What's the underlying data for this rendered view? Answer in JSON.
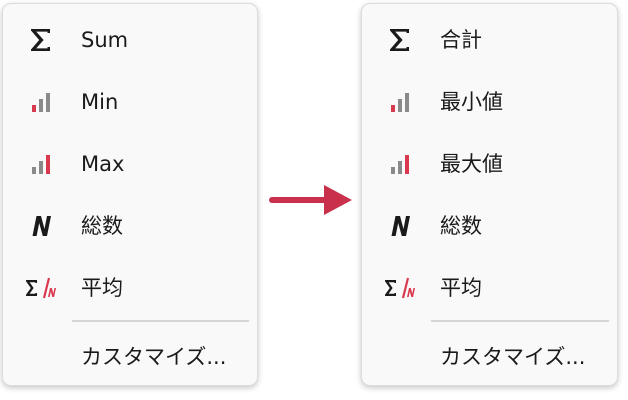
{
  "left_menu": {
    "items": [
      {
        "label": "Sum",
        "icon": "sigma-icon"
      },
      {
        "label": "Min",
        "icon": "min-bars-icon"
      },
      {
        "label": "Max",
        "icon": "max-bars-icon"
      },
      {
        "label": "総数",
        "icon": "count-n-icon"
      },
      {
        "label": "平均",
        "icon": "average-icon"
      }
    ],
    "customize_label": "カスタマイズ..."
  },
  "right_menu": {
    "items": [
      {
        "label": "合計",
        "icon": "sigma-icon"
      },
      {
        "label": "最小値",
        "icon": "min-bars-icon"
      },
      {
        "label": "最大値",
        "icon": "max-bars-icon"
      },
      {
        "label": "総数",
        "icon": "count-n-icon"
      },
      {
        "label": "平均",
        "icon": "average-icon"
      }
    ],
    "customize_label": "カスタマイズ..."
  },
  "colors": {
    "accent_red": "#d9394e",
    "arrow": "#c8304c",
    "icon_dark": "#1a1a1a",
    "icon_gray": "#8a8a8a"
  }
}
